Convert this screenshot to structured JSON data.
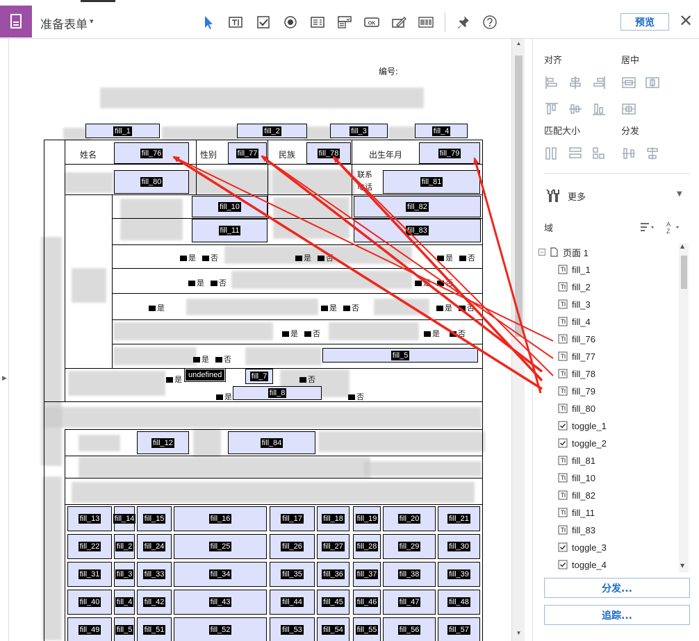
{
  "toolbar": {
    "title": "准备表单",
    "title_caret": "▾",
    "preview_label": "预览",
    "close_symbol": "✕",
    "tools": [
      "select-pointer-icon",
      "text-field-icon",
      "checkbox-icon",
      "radio-button-icon",
      "list-box-icon",
      "dropdown-icon",
      "ok-button-icon",
      "signature-icon",
      "barcode-icon",
      "pin-icon",
      "help-icon"
    ]
  },
  "document": {
    "number_label": "编号:",
    "labels": {
      "name": "姓名",
      "gender": "性别",
      "ethnicity": "民族",
      "birth": "出生年月",
      "contact1": "联系",
      "contact2": "电话"
    },
    "yes": "是",
    "no": "否",
    "undefined_field": "undefined",
    "fields": {
      "fill_1": "fill_1",
      "fill_2": "fill_2",
      "fill_3": "fill_3",
      "fill_4": "fill_4",
      "fill_76": "fill_76",
      "fill_77": "fill_77",
      "fill_78": "fill_78",
      "fill_79": "fill_79",
      "fill_80": "fill_80",
      "fill_81": "fill_81",
      "fill_10": "fill_10",
      "fill_82": "fill_82",
      "fill_11": "fill_11",
      "fill_83": "fill_83",
      "fill_5": "fill_5",
      "fill_7": "fill_7",
      "fill_8": "fill_8",
      "fill_12": "fill_12",
      "fill_84": "fill_84"
    },
    "grid_rows": [
      [
        "fill_13",
        "fill_14",
        "fill_15",
        "fill_16",
        "fill_17",
        "fill_18",
        "fill_19",
        "fill_20",
        "fill_21"
      ],
      [
        "fill_22",
        "fill_23",
        "fill_24",
        "fill_25",
        "fill_26",
        "fill_27",
        "fill_28",
        "fill_29",
        "fill_30"
      ],
      [
        "fill_31",
        "fill_32",
        "fill_33",
        "fill_34",
        "fill_35",
        "fill_36",
        "fill_37",
        "fill_38",
        "fill_39"
      ],
      [
        "fill_40",
        "fill_41",
        "fill_42",
        "fill_43",
        "fill_44",
        "fill_45",
        "fill_46",
        "fill_47",
        "fill_48"
      ],
      [
        "fill_49",
        "fill_50",
        "fill_51",
        "fill_52",
        "fill_53",
        "fill_54",
        "fill_55",
        "fill_56",
        "fill_57"
      ]
    ],
    "grid_rows_visible_text": [
      [
        "fill_13",
        "fill_14",
        "fill_15",
        "fill_16",
        "fill_17",
        "fill_18",
        "fill_19",
        "fill_20",
        "fill_21"
      ],
      [
        "fill_22",
        "fill_2",
        "fill_24",
        "fill_25",
        "fill_26",
        "fill_27",
        "fill_28",
        "fill_29",
        "fill_30"
      ],
      [
        "fill_31",
        "fill_3",
        "fill_33",
        "fill_34",
        "fill_35",
        "fill_36",
        "fill_37",
        "fill_38",
        "fill_39"
      ],
      [
        "fill_40",
        "fill_4",
        "fill_42",
        "fill_43",
        "fill_44",
        "fill_45",
        "fill_46",
        "fill_47",
        "fill_48"
      ],
      [
        "fill_49",
        "fill_5",
        "fill_51",
        "fill_52",
        "fill_53",
        "fill_54",
        "fill_55",
        "fill_56",
        "fill_57"
      ]
    ],
    "misc_text": [
      "培",
      "(",
      "公",
      "机"
    ]
  },
  "panel": {
    "align_label": "对齐",
    "center_label": "居中",
    "match_size_label": "匹配大小",
    "distribute_label": "分发",
    "more_label": "更多",
    "fields_label": "域",
    "page_label": "页面 1",
    "tree_items": [
      {
        "name": "fill_1",
        "type": "text"
      },
      {
        "name": "fill_2",
        "type": "text"
      },
      {
        "name": "fill_3",
        "type": "text"
      },
      {
        "name": "fill_4",
        "type": "text"
      },
      {
        "name": "fill_76",
        "type": "text"
      },
      {
        "name": "fill_77",
        "type": "text"
      },
      {
        "name": "fill_78",
        "type": "text"
      },
      {
        "name": "fill_79",
        "type": "text"
      },
      {
        "name": "fill_80",
        "type": "text"
      },
      {
        "name": "toggle_1",
        "type": "check"
      },
      {
        "name": "toggle_2",
        "type": "check"
      },
      {
        "name": "fill_81",
        "type": "text"
      },
      {
        "name": "fill_10",
        "type": "text"
      },
      {
        "name": "fill_82",
        "type": "text"
      },
      {
        "name": "fill_11",
        "type": "text"
      },
      {
        "name": "fill_83",
        "type": "text"
      },
      {
        "name": "toggle_3",
        "type": "check"
      },
      {
        "name": "toggle_4",
        "type": "check"
      }
    ],
    "distribute_button": "分发...",
    "track_button": "追踪..."
  },
  "colors": {
    "accent_purple": "#9c4fa4",
    "link_blue": "#1b6ac9",
    "field_fill": "#dde1fb",
    "arrow_red": "#f0261c"
  }
}
